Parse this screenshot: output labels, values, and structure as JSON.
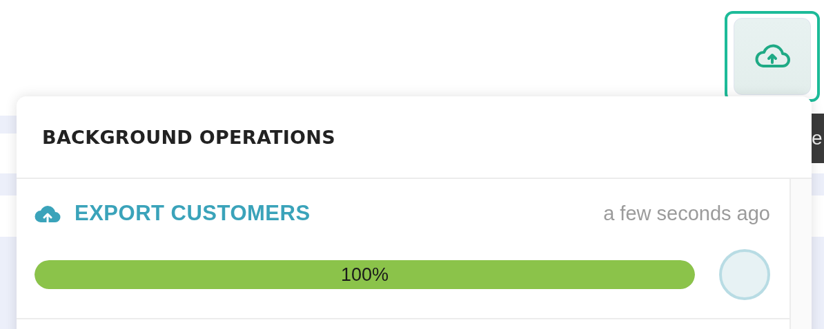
{
  "upload_button": {
    "focused": true
  },
  "behind_tooltip": "e",
  "panel": {
    "title": "BACKGROUND OPERATIONS",
    "operations": [
      {
        "name": "EXPORT CUSTOMERS",
        "time": "a few seconds ago",
        "level": 1,
        "reading": "100%"
      }
    ]
  }
}
